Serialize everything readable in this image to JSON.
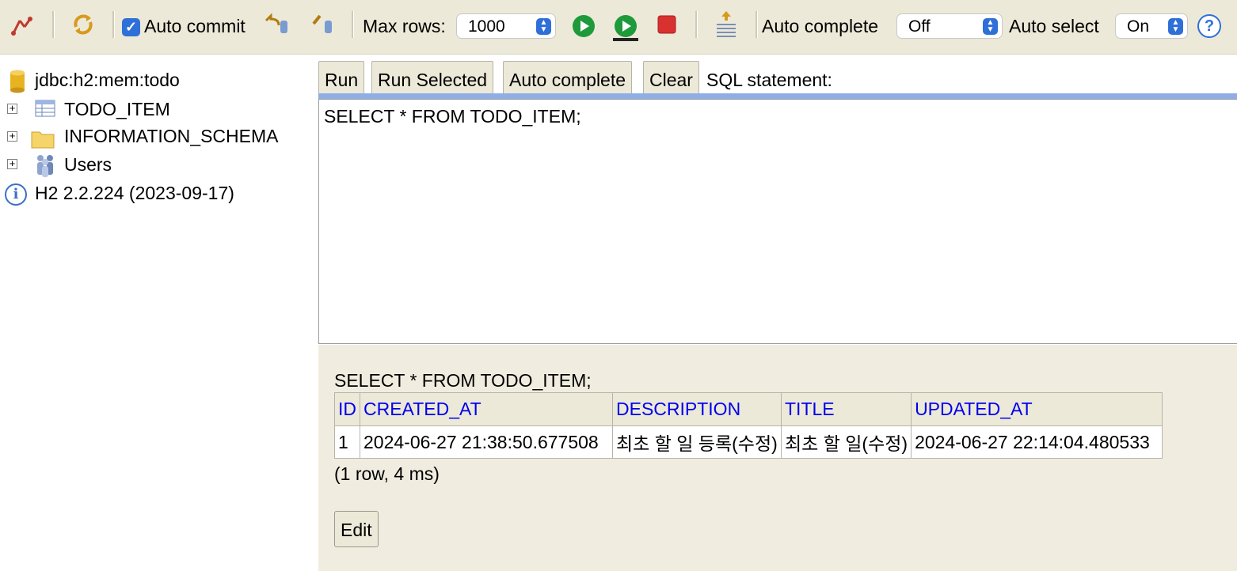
{
  "toolbar": {
    "auto_commit_label": "Auto commit",
    "max_rows_label": "Max rows:",
    "max_rows_value": "1000",
    "auto_complete_label": "Auto complete",
    "auto_complete_value": "Off",
    "auto_select_label": "Auto select",
    "auto_select_value": "On",
    "help_glyph": "?",
    "colors": {
      "accent": "#2f6fd8",
      "run_green": "#1e9a3a",
      "stop_red": "#d93030"
    }
  },
  "tree": {
    "connection": "jdbc:h2:mem:todo",
    "items": [
      {
        "label": "TODO_ITEM",
        "icon": "table-icon"
      },
      {
        "label": "INFORMATION_SCHEMA",
        "icon": "folder-icon"
      },
      {
        "label": "Users",
        "icon": "users-icon"
      }
    ],
    "version": "H2 2.2.224 (2023-09-17)"
  },
  "buttons": {
    "run": "Run",
    "run_selected": "Run Selected",
    "auto_complete": "Auto complete",
    "clear": "Clear",
    "sql_statement_label": "SQL statement:"
  },
  "editor": {
    "sql": "SELECT * FROM TODO_ITEM;"
  },
  "results": {
    "query": "SELECT * FROM TODO_ITEM;",
    "columns": [
      "ID",
      "CREATED_AT",
      "DESCRIPTION",
      "TITLE",
      "UPDATED_AT"
    ],
    "rows": [
      [
        "1",
        "2024-06-27 21:38:50.677508",
        "최초 할 일 등록(수정)",
        "최초 할 일(수정)",
        "2024-06-27 22:14:04.480533"
      ]
    ],
    "summary": "(1 row, 4 ms)",
    "edit_label": "Edit"
  }
}
